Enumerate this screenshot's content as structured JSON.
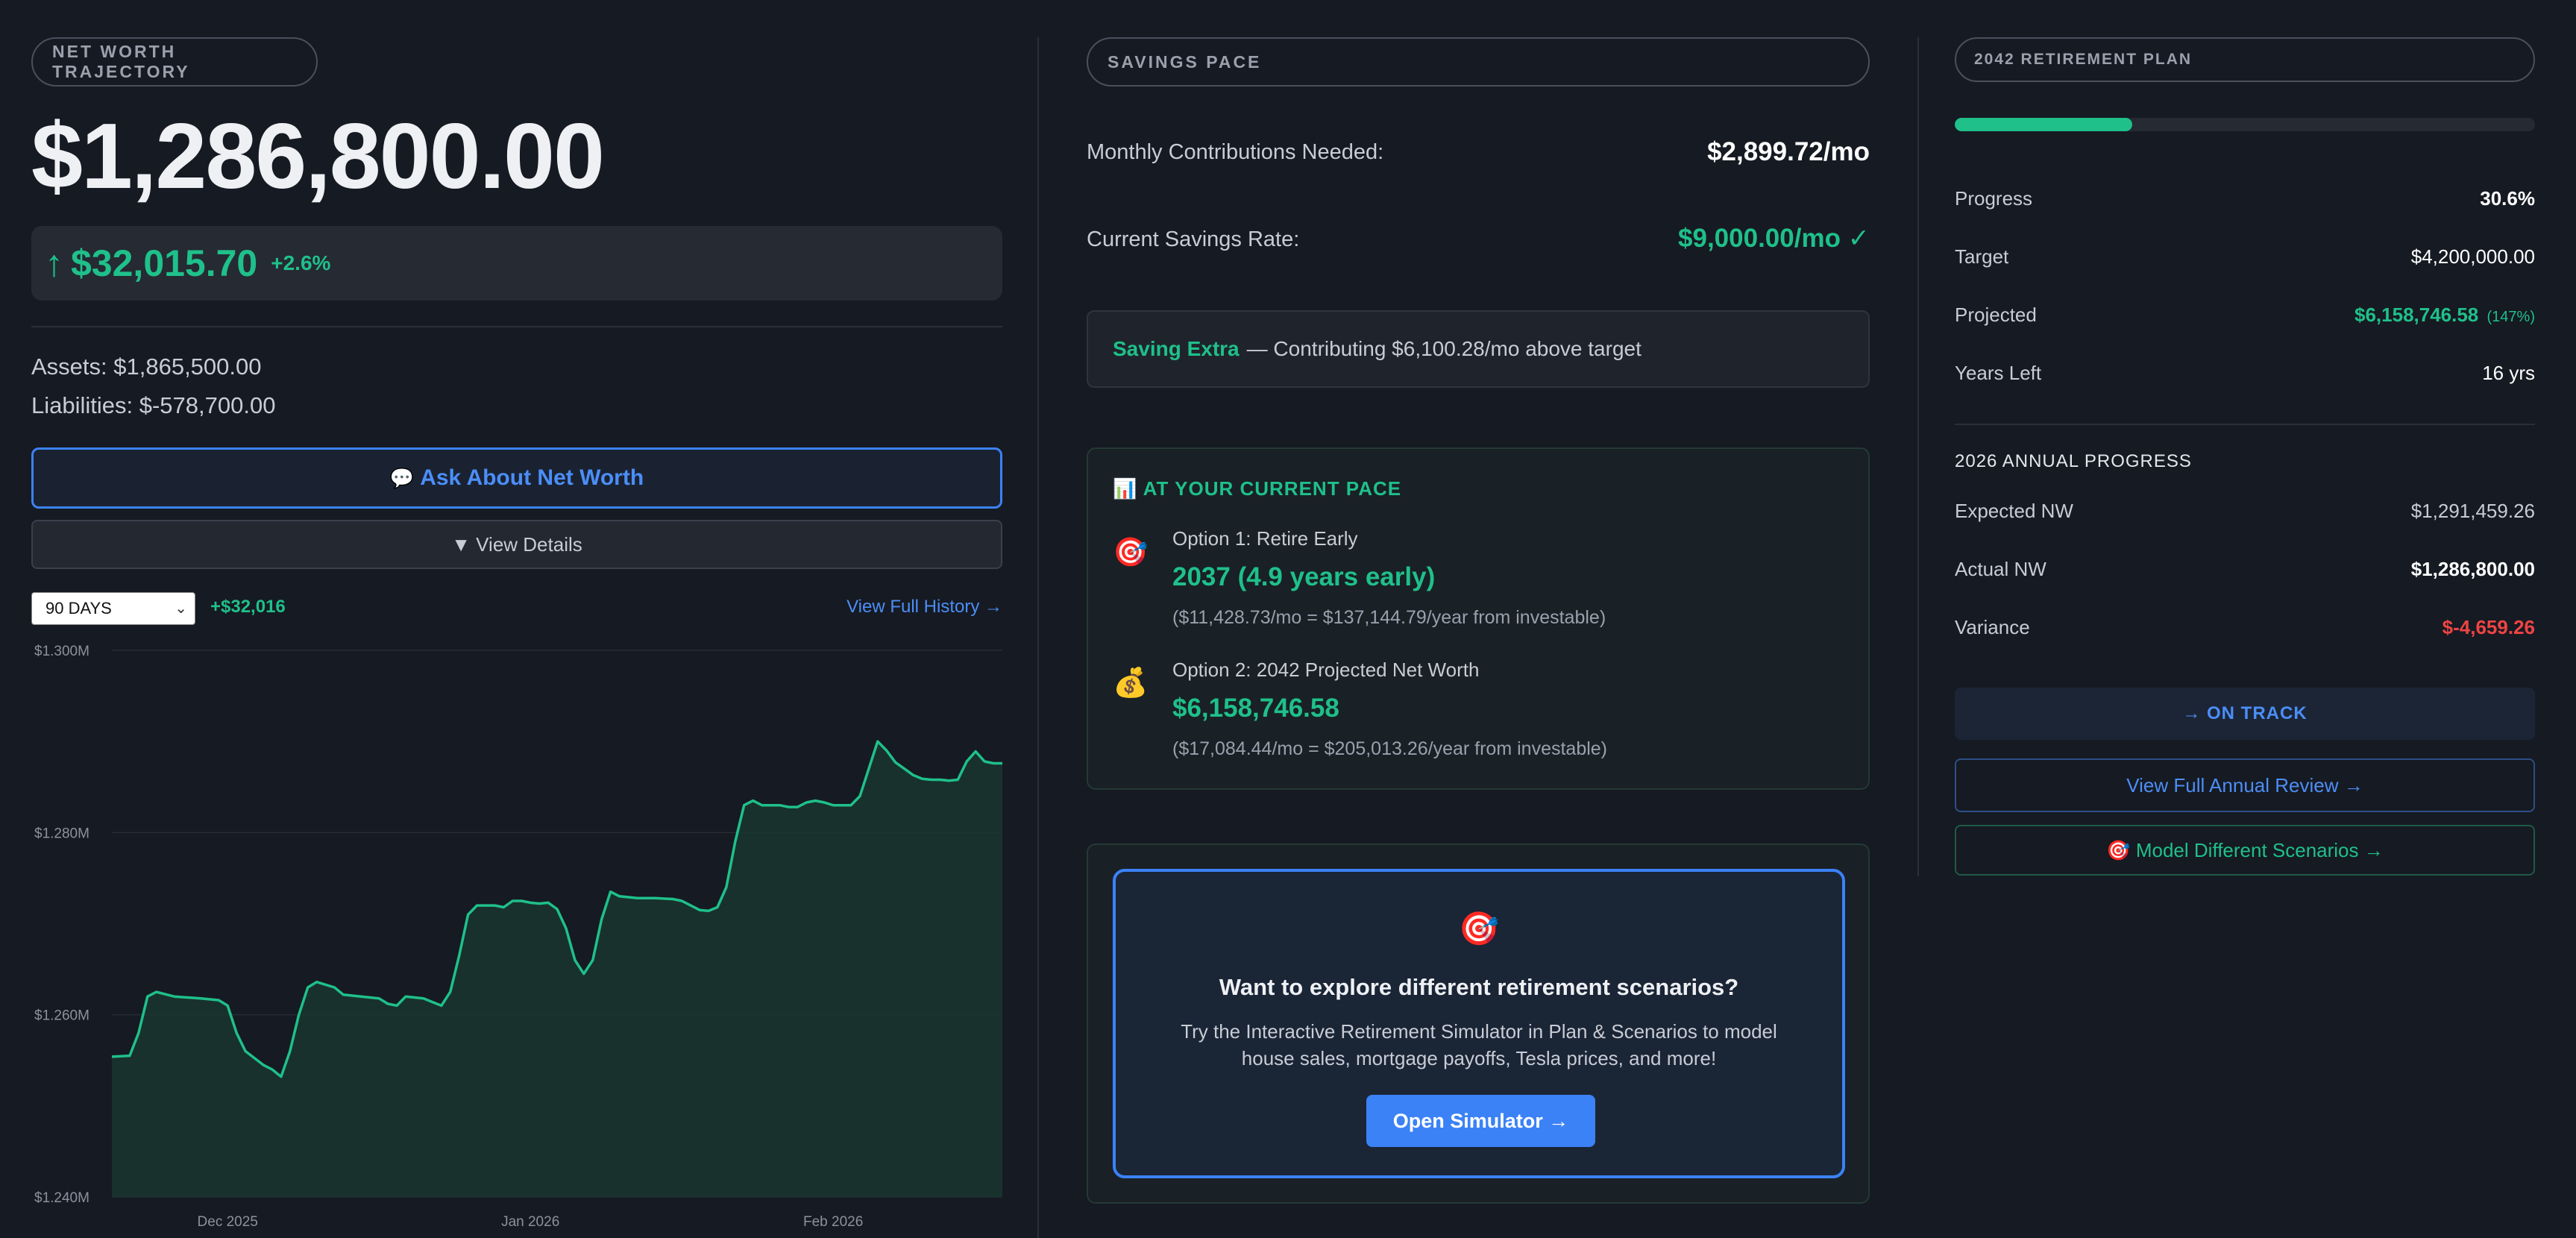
{
  "net_worth": {
    "pill": "NET WORTH TRAJECTORY",
    "value": "$1,286,800.00",
    "change_arrow": "↑",
    "change_amount": "$32,015.70",
    "change_pct": "+2.6%",
    "assets": "Assets: $1,865,500.00",
    "liabilities": "Liabilities: $-578,700.00",
    "ask_icon": "speech-bubble-icon",
    "ask_glyph": "💬",
    "ask_label": "Ask About Net Worth",
    "details_label": "▼ View Details",
    "range_selected": "90 DAYS",
    "range_change": "+$32,016",
    "history_link": "View Full History →"
  },
  "chart_data": {
    "type": "area",
    "title": "",
    "xlabel": "",
    "ylabel": "",
    "ylim": [
      1240000,
      1300000
    ],
    "y_ticks": [
      1240000,
      1260000,
      1280000,
      1300000
    ],
    "y_tick_labels": [
      "$1.240M",
      "$1.260M",
      "$1.280M",
      "$1.300M"
    ],
    "x_tick_labels": [
      "Dec 2025",
      "Jan 2026",
      "Feb 2026"
    ],
    "x_tick_day_index": [
      13,
      47,
      81
    ],
    "grid": true,
    "series_color": "#1fc08a",
    "x_range_days": [
      0,
      100
    ],
    "points": [
      [
        0,
        1255400
      ],
      [
        2,
        1255500
      ],
      [
        3,
        1258000
      ],
      [
        4,
        1262000
      ],
      [
        5,
        1262500
      ],
      [
        7,
        1262000
      ],
      [
        10,
        1261800
      ],
      [
        12,
        1261600
      ],
      [
        13,
        1261000
      ],
      [
        14,
        1258000
      ],
      [
        15,
        1256000
      ],
      [
        17,
        1254500
      ],
      [
        18,
        1254000
      ],
      [
        19,
        1253200
      ],
      [
        20,
        1256000
      ],
      [
        21,
        1260000
      ],
      [
        22,
        1263000
      ],
      [
        23,
        1263600
      ],
      [
        25,
        1263000
      ],
      [
        26,
        1262200
      ],
      [
        28,
        1262000
      ],
      [
        30,
        1261800
      ],
      [
        31,
        1261200
      ],
      [
        32,
        1261000
      ],
      [
        33,
        1262000
      ],
      [
        35,
        1261800
      ],
      [
        36,
        1261400
      ],
      [
        37,
        1261000
      ],
      [
        38,
        1262500
      ],
      [
        39,
        1266500
      ],
      [
        40,
        1271000
      ],
      [
        41,
        1272000
      ],
      [
        43,
        1272000
      ],
      [
        44,
        1271800
      ],
      [
        45,
        1272500
      ],
      [
        46,
        1272500
      ],
      [
        47,
        1272300
      ],
      [
        48,
        1272200
      ],
      [
        49,
        1272300
      ],
      [
        50,
        1271600
      ],
      [
        51,
        1269500
      ],
      [
        52,
        1266000
      ],
      [
        53,
        1264500
      ],
      [
        54,
        1266000
      ],
      [
        55,
        1270500
      ],
      [
        56,
        1273500
      ],
      [
        57,
        1273000
      ],
      [
        59,
        1272800
      ],
      [
        61,
        1272800
      ],
      [
        63,
        1272700
      ],
      [
        64,
        1272500
      ],
      [
        65,
        1272000
      ],
      [
        66,
        1271500
      ],
      [
        67,
        1271400
      ],
      [
        68,
        1271800
      ],
      [
        69,
        1274000
      ],
      [
        70,
        1279000
      ],
      [
        71,
        1283000
      ],
      [
        72,
        1283500
      ],
      [
        73,
        1283000
      ],
      [
        75,
        1283000
      ],
      [
        76,
        1282800
      ],
      [
        77,
        1282800
      ],
      [
        78,
        1283300
      ],
      [
        79,
        1283500
      ],
      [
        80,
        1283300
      ],
      [
        81,
        1283000
      ],
      [
        82,
        1283000
      ],
      [
        83,
        1283000
      ],
      [
        84,
        1284000
      ],
      [
        85,
        1287000
      ],
      [
        86,
        1290000
      ],
      [
        87,
        1289000
      ],
      [
        88,
        1287700
      ],
      [
        89,
        1287000
      ],
      [
        90,
        1286300
      ],
      [
        91,
        1285900
      ],
      [
        92,
        1285800
      ],
      [
        93,
        1285800
      ],
      [
        94,
        1285700
      ],
      [
        95,
        1285800
      ],
      [
        96,
        1287800
      ],
      [
        97,
        1288900
      ],
      [
        98,
        1287800
      ],
      [
        99,
        1287600
      ],
      [
        100,
        1287600
      ]
    ]
  },
  "savings": {
    "pill": "SAVINGS PACE",
    "needed_label": "Monthly Contributions Needed:",
    "needed_value": "$2,899.72/mo",
    "rate_label": "Current Savings Rate:",
    "rate_value": "$9,000.00/mo ✓",
    "extra_highlight": "Saving Extra",
    "extra_text": "— Contributing $6,100.28/mo above target"
  },
  "pace": {
    "title_icon": "📊",
    "title": "AT YOUR CURRENT PACE",
    "options": [
      {
        "icon_name": "target-icon",
        "icon_glyph": "🎯",
        "name": "Option 1: Retire Early",
        "value": "2037 (4.9 years early)",
        "detail": "($11,428.73/mo = $137,144.79/year from investable)"
      },
      {
        "icon_name": "money-bag-icon",
        "icon_glyph": "💰",
        "name": "Option 2: 2042 Projected Net Worth",
        "value": "$6,158,746.58",
        "detail": "($17,084.44/mo = $205,013.26/year from investable)"
      }
    ]
  },
  "simulator": {
    "icon_name": "target-icon",
    "icon_glyph": "🎯",
    "title": "Want to explore different retirement scenarios?",
    "desc": "Try the Interactive Retirement Simulator in Plan & Scenarios to model house sales, mortgage payoffs, Tesla prices, and more!",
    "button": "Open Simulator →"
  },
  "plan": {
    "pill": "2042 RETIREMENT PLAN",
    "progress_fraction": 0.306,
    "rows": [
      {
        "label": "Progress",
        "value": "30.6%",
        "color": "#ffffff",
        "bold": true
      },
      {
        "label": "Target",
        "value": "$4,200,000.00",
        "color": "#ffffff",
        "bold": false
      },
      {
        "label": "Projected",
        "value": "$6,158,746.58",
        "suffix": "(147%)",
        "color": "#1fc08a",
        "bold": true
      },
      {
        "label": "Years Left",
        "value": "16 yrs",
        "color": "#ffffff",
        "bold": false
      }
    ],
    "annual_heading": "2026 ANNUAL PROGRESS",
    "annual_rows": [
      {
        "label": "Expected NW",
        "value": "$1,291,459.26",
        "color": "#c8ccd4",
        "bold": false
      },
      {
        "label": "Actual NW",
        "value": "$1,286,800.00",
        "color": "#ffffff",
        "bold": true
      },
      {
        "label": "Variance",
        "value": "$-4,659.26",
        "color": "#ef4444",
        "bold": true
      }
    ],
    "status": "→ ON TRACK",
    "review_button": "View Full Annual Review →",
    "scenario_button": "🎯 Model Different Scenarios →"
  },
  "colors": {
    "background": "#161a22",
    "positive": "#1fc08a",
    "accent": "#3b82f6",
    "negative": "#ef4444"
  }
}
